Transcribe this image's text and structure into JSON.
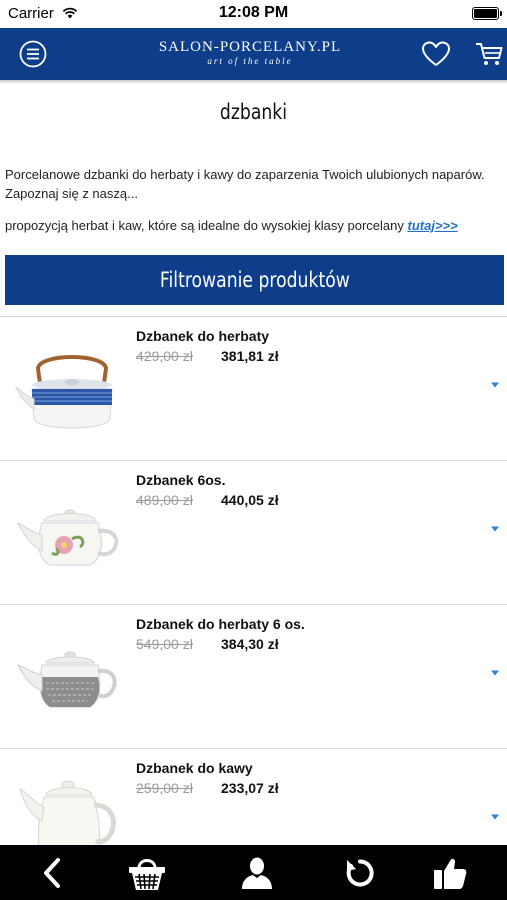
{
  "status_bar": {
    "carrier": "Carrier",
    "time": "12:08 PM",
    "battery_level": 1.0
  },
  "header": {
    "logo_brand": "SALON-PORCELANY.PL",
    "logo_tagline": "art of the table",
    "menu_icon": "menu-icon",
    "favorites_icon": "heart-icon",
    "cart_icon": "cart-icon",
    "color": "#0e3d8a"
  },
  "page": {
    "title": "dzbanki",
    "description_1": "Porcelanowe dzbanki do herbaty i kawy do zaparzenia Twoich ulubionych naparów. Zapoznaj się z naszą...",
    "description_2": "propozycją herbat i kaw, które są idealne do wysokiej klasy porcelany ",
    "description_link": "tutaj>>>",
    "link_color": "#1e6fce"
  },
  "filter": {
    "label": "Filtrowanie produktów"
  },
  "products": [
    {
      "name": "Dzbanek do herbaty",
      "old_price": "429,00 zł",
      "price": "381,81 zł",
      "image": "blue-pattern-teapot"
    },
    {
      "name": "Dzbanek 6os.",
      "old_price": "489,00 zł",
      "price": "440,05 zł",
      "image": "floral-teapot"
    },
    {
      "name": "Dzbanek do herbaty 6 os.",
      "old_price": "549,00 zł",
      "price": "384,30 zł",
      "image": "grey-pattern-teapot"
    },
    {
      "name": "Dzbanek do kawy",
      "old_price": "259,00 zł",
      "price": "233,07 zł",
      "image": "white-coffee-pot"
    }
  ],
  "toolbar": {
    "items": [
      "back-icon",
      "basket-icon",
      "user-icon",
      "refresh-icon",
      "thumbs-up-icon"
    ]
  }
}
